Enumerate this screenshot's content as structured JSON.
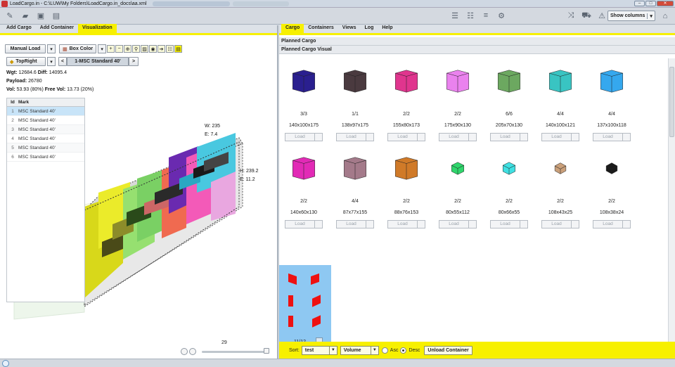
{
  "window": {
    "title": "LoadCargo.in - C:\\LUW\\My Folders\\LoadCargo.in_docs\\aa.xml"
  },
  "toolbar": {
    "show_columns": "Show columns"
  },
  "left": {
    "tabs": [
      "Add Cargo",
      "Add Container",
      "Visualization"
    ],
    "active_tab": "Visualization",
    "manual_load": "Manual Load",
    "box_color": "Box Color",
    "view": "TopRight",
    "container_select": "1-MSC Standard 40'",
    "prev": "<",
    "next": ">",
    "wgt_label": "Wgt:",
    "wgt_value": "12684.6",
    "diff_label": "Diff:",
    "diff_value": "14095.4",
    "payload_label": "Payload:",
    "payload_value": "26780",
    "vol_label": "Vol:",
    "vol_value": "53.93 (80%)",
    "freevol_label": "Free Vol:",
    "freevol_value": "13.73 (20%)",
    "grid_headers": [
      "Id",
      "Mark"
    ],
    "grid_rows": [
      {
        "id": "1",
        "mark": "MSC Standard 40'"
      },
      {
        "id": "2",
        "mark": "MSC Standard 40'"
      },
      {
        "id": "3",
        "mark": "MSC Standard 40'"
      },
      {
        "id": "4",
        "mark": "MSC Standard 40'"
      },
      {
        "id": "5",
        "mark": "MSC Standard 40'"
      },
      {
        "id": "6",
        "mark": "MSC Standard 40'"
      }
    ],
    "dim_w": "W: 235",
    "dim_e1": "E: 7.4",
    "dim_h": "H: 239.2",
    "dim_e2": "E: 11.2",
    "slider_value": "29"
  },
  "right": {
    "tabs": [
      "Cargo",
      "Containers",
      "Views",
      "Log",
      "Help"
    ],
    "active_tab": "Cargo",
    "section1": "Planned Cargo",
    "section2": "Planned Cargo Visual",
    "load_label": "Load",
    "items": [
      {
        "count": "3/3",
        "dims": "140x100x175",
        "color": "#2a1f8f"
      },
      {
        "count": "1/1",
        "dims": "138x97x175",
        "color": "#4a3a3f"
      },
      {
        "count": "2/2",
        "dims": "155x80x173",
        "color": "#e0358e"
      },
      {
        "count": "2/2",
        "dims": "175x90x130",
        "color": "#ea82ee"
      },
      {
        "count": "6/6",
        "dims": "205x70x130",
        "color": "#6ca860"
      },
      {
        "count": "4/4",
        "dims": "140x100x121",
        "color": "#39c4c2"
      },
      {
        "count": "4/4",
        "dims": "137x100x118",
        "color": "#35a8ee"
      },
      {
        "count": "2/2",
        "dims": "140x60x130",
        "color": "#e22ab6"
      },
      {
        "count": "4/4",
        "dims": "87x77x155",
        "color": "#a47a8a"
      },
      {
        "count": "2/2",
        "dims": "88x76x153",
        "color": "#d07a28"
      },
      {
        "count": "2/2",
        "dims": "80x55x112",
        "color": "#2fd66c"
      },
      {
        "count": "2/2",
        "dims": "80x66x55",
        "color": "#3fe0e2"
      },
      {
        "count": "2/2",
        "dims": "108x43x25",
        "color": "#caa07a"
      },
      {
        "count": "2/2",
        "dims": "108x38x24",
        "color": "#1a1a1a"
      }
    ],
    "selected_count": "11/12",
    "sort_label": "Sort:",
    "sort_field": "test",
    "sort_by": "Volume",
    "asc": "Asc",
    "desc": "Desc",
    "unload": "Unload Container"
  }
}
